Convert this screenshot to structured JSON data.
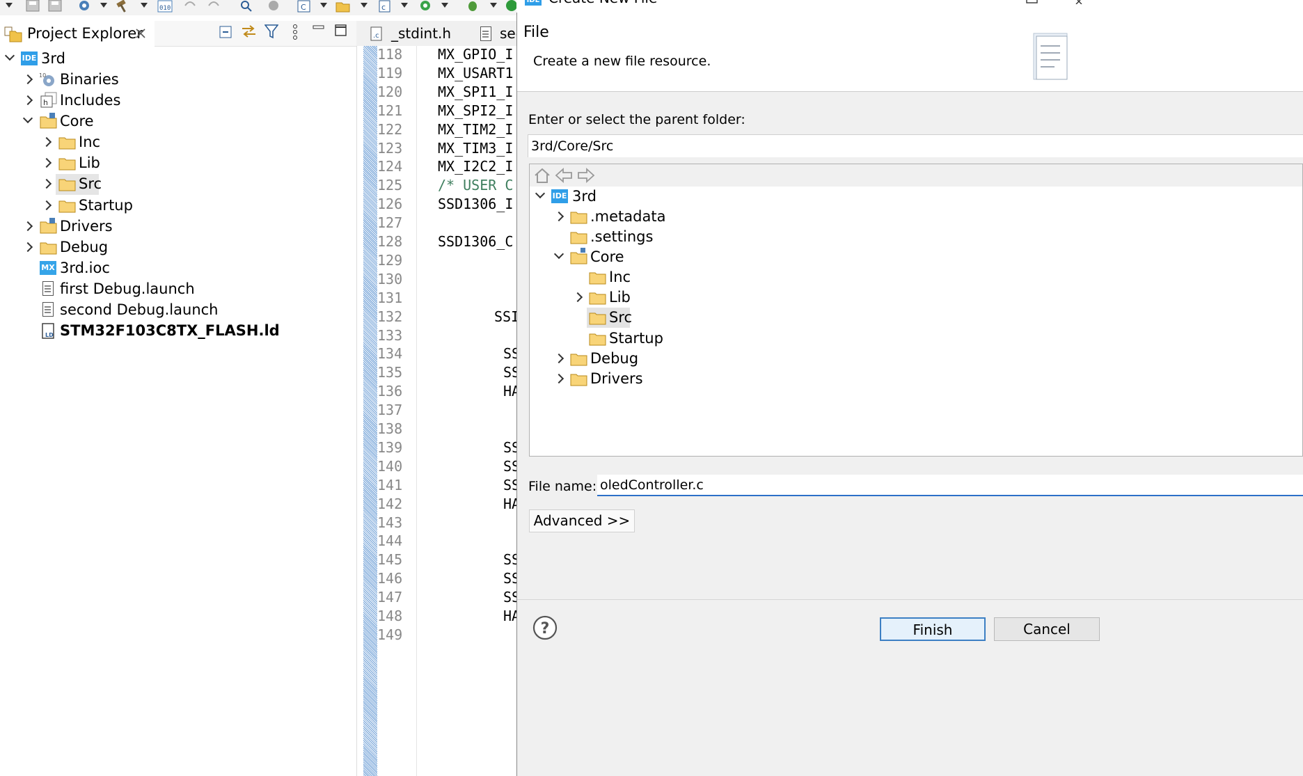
{
  "project_explorer": {
    "tab_title": "Project Explorer",
    "items": [
      {
        "label": "3rd"
      },
      {
        "label": "Binaries"
      },
      {
        "label": "Includes"
      },
      {
        "label": "Core"
      },
      {
        "label": "Inc"
      },
      {
        "label": "Lib"
      },
      {
        "label": "Src"
      },
      {
        "label": "Startup"
      },
      {
        "label": "Drivers"
      },
      {
        "label": "Debug"
      },
      {
        "label": "3rd.ioc"
      },
      {
        "label": "first Debug.launch"
      },
      {
        "label": "second Debug.launch"
      },
      {
        "label": "STM32F103C8TX_FLASH.ld"
      }
    ]
  },
  "editor": {
    "tabs": [
      {
        "label": "_stdint.h"
      },
      {
        "label": "sec"
      }
    ],
    "line_numbers": [
      "118",
      "119",
      "120",
      "121",
      "122",
      "123",
      "124",
      "125",
      "126",
      "127",
      "128",
      "129",
      "130",
      "131",
      "132",
      "133",
      "134",
      "135",
      "136",
      "137",
      "138",
      "139",
      "140",
      "141",
      "142",
      "143",
      "144",
      "145",
      "146",
      "147",
      "148",
      "149"
    ],
    "code": [
      "MX_GPIO_I",
      "MX_USART1",
      "MX_SPI1_I",
      "MX_SPI2_I",
      "MX_TIM2_I",
      "MX_TIM3_I",
      "MX_I2C2_I",
      "/* USER C",
      "SSD1306_I",
      "",
      "SSD1306_C",
      "",
      "",
      "",
      "SSI",
      "",
      "SS",
      "SS",
      "HA",
      "",
      "",
      "SS",
      "SS",
      "SS",
      "HA",
      "",
      "",
      "SS",
      "SS",
      "SS",
      "HA",
      ""
    ]
  },
  "dialog": {
    "window_title": "Create New File",
    "banner_title": "File",
    "banner_description": "Create a new file resource.",
    "parent_folder_label": "Enter or select the parent folder:",
    "parent_folder_value": "3rd/Core/Src",
    "tree": [
      {
        "label": "3rd"
      },
      {
        "label": ".metadata"
      },
      {
        "label": ".settings"
      },
      {
        "label": "Core"
      },
      {
        "label": "Inc"
      },
      {
        "label": "Lib"
      },
      {
        "label": "Src"
      },
      {
        "label": "Startup"
      },
      {
        "label": "Debug"
      },
      {
        "label": "Drivers"
      }
    ],
    "file_name_label": "File name:",
    "file_name_value": "oledController.c",
    "advanced_button": "Advanced >>",
    "finish_button": "Finish",
    "cancel_button": "Cancel",
    "help_glyph": "?"
  }
}
